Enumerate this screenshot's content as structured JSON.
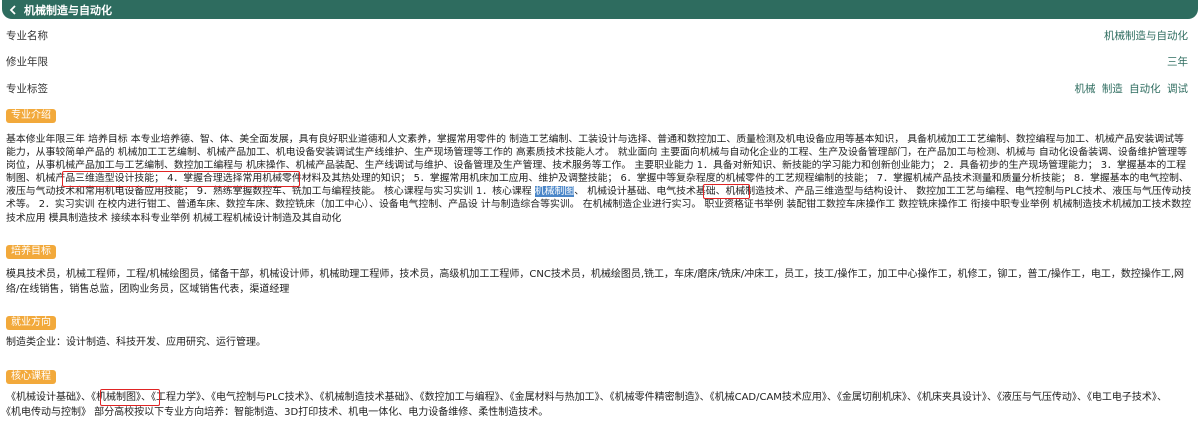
{
  "header": {
    "title": "机械制造与自动化"
  },
  "info": [
    {
      "label": "专业名称",
      "value": "机械制造与自动化"
    },
    {
      "label": "修业年限",
      "value": "三年"
    },
    {
      "label": "专业标签",
      "tags": [
        "机械",
        "制造",
        "自动化",
        "调试"
      ]
    }
  ],
  "sections": {
    "intro": {
      "title": "专业介绍",
      "text_before": "基本修业年限三年 培养目标 本专业培养德、智、体、美全面发展，具有良好职业道德和人文素养，掌握常用零件的 制造工艺编制、工装设计与选择、普通和数控加工、质量检测及机电设备应用等基本知识， 具备机械加工工艺编制、数控编程与加工、机械产品安装调试等能力，从事较简单产品的 机械加工工艺编制、机械产品加工、机电设备安装调试生产线维护、生产现场管理等工作的 高素质技术技能人才。 就业面向 主要面向机械与自动化企业的工程、生产及设备管理部门，在产品加工与检测、机械与 自动化设备装调、设备维护管理等岗位，从事机械产品加工与工艺编制、数控加工编程与 机床操作、机械产品装配、生产线调试与维护、设备管理及生产管理、技术服务等工作。 主要职业能力 1．具备对新知识、新技能的学习能力和创新创业能力； 2．具备初步的生产现场管理能力； 3．掌握基本的工程制图、机械产品三维造型设计技能； 4．掌握合理选择常用机械零件材料及其热处理的知识； 5．掌握常用机床加工应用、维护及调整技能； 6．掌握中等复杂程度的机械零件的工艺规程编制的技能； 7．掌握机械产品技术测量和质量分析技能； 8．掌握基本的电气控制、液压与气动技术和常用机电设备应用技能； 9．熟练掌握数控车、铣加工与编程技能。 核心课程与实习实训 1．核心课程 ",
      "highlight": "机械制图",
      "text_after": "、 机械设计基础、电气技术基础、机械制造技术、产品三维造型与结构设计、 数控加工工艺与编程、电气控制与PLC技术、液压与气压传动技术等。 2．实习实训 在校内进行钳工、普通车床、数控车床、数控铣床（加工中心）、设备电气控制、产品设 计与制造综合等实训。 在机械制造企业进行实习。 职业资格证书举例 装配钳工数控车床操作工 数控铣床操作工 衔接中职专业举例 机械制造技术机械加工技术数控技术应用 模具制造技术 接续本科专业举例 机械工程机械设计制造及其自动化"
    },
    "goal": {
      "title": "培养目标",
      "text": "模具技术员，机械工程师，工程/机械绘图员，储备干部，机械设计师，机械助理工程师，技术员，高级机加工工程师，CNC技术员，机械绘图员,铣工，车床/磨床/铣床/冲床工，员工，技工/操作工，加工中心操作工，机修工，铆工，普工/操作工，电工，数控操作工,网络/在线销售，销售总监，团购业务员，区域销售代表，渠道经理"
    },
    "career": {
      "title": "就业方向",
      "text": "制造类企业：设计制造、科技开发、应用研究、运行管理。"
    },
    "core": {
      "title": "核心课程",
      "courses": [
        "《机械设计基础》",
        "《机械制图》",
        "《工程力学》",
        "《电气控制与PLC技术》",
        "《机械制造技术基础》",
        "《数控加工与编程》",
        "《金属材料与热加工》",
        "《机械零件精密制造》",
        "《机械CAD/CAM技术应用》",
        "《金属切削机床》",
        "《机床夹具设计》",
        "《液压与气压传动》",
        "《电工电子技术》",
        "《机电传动与控制》"
      ],
      "tail": " 部分高校按以下专业方向培养：智能制造、3D打印技术、机电一体化、电力设备维修、柔性制造技术。"
    }
  },
  "colors": {
    "header_bg": "#2e6c5f",
    "badge_bg": "#f2a93b",
    "highlight_bg": "#4a86c8",
    "annotation_box": "#e02424"
  }
}
